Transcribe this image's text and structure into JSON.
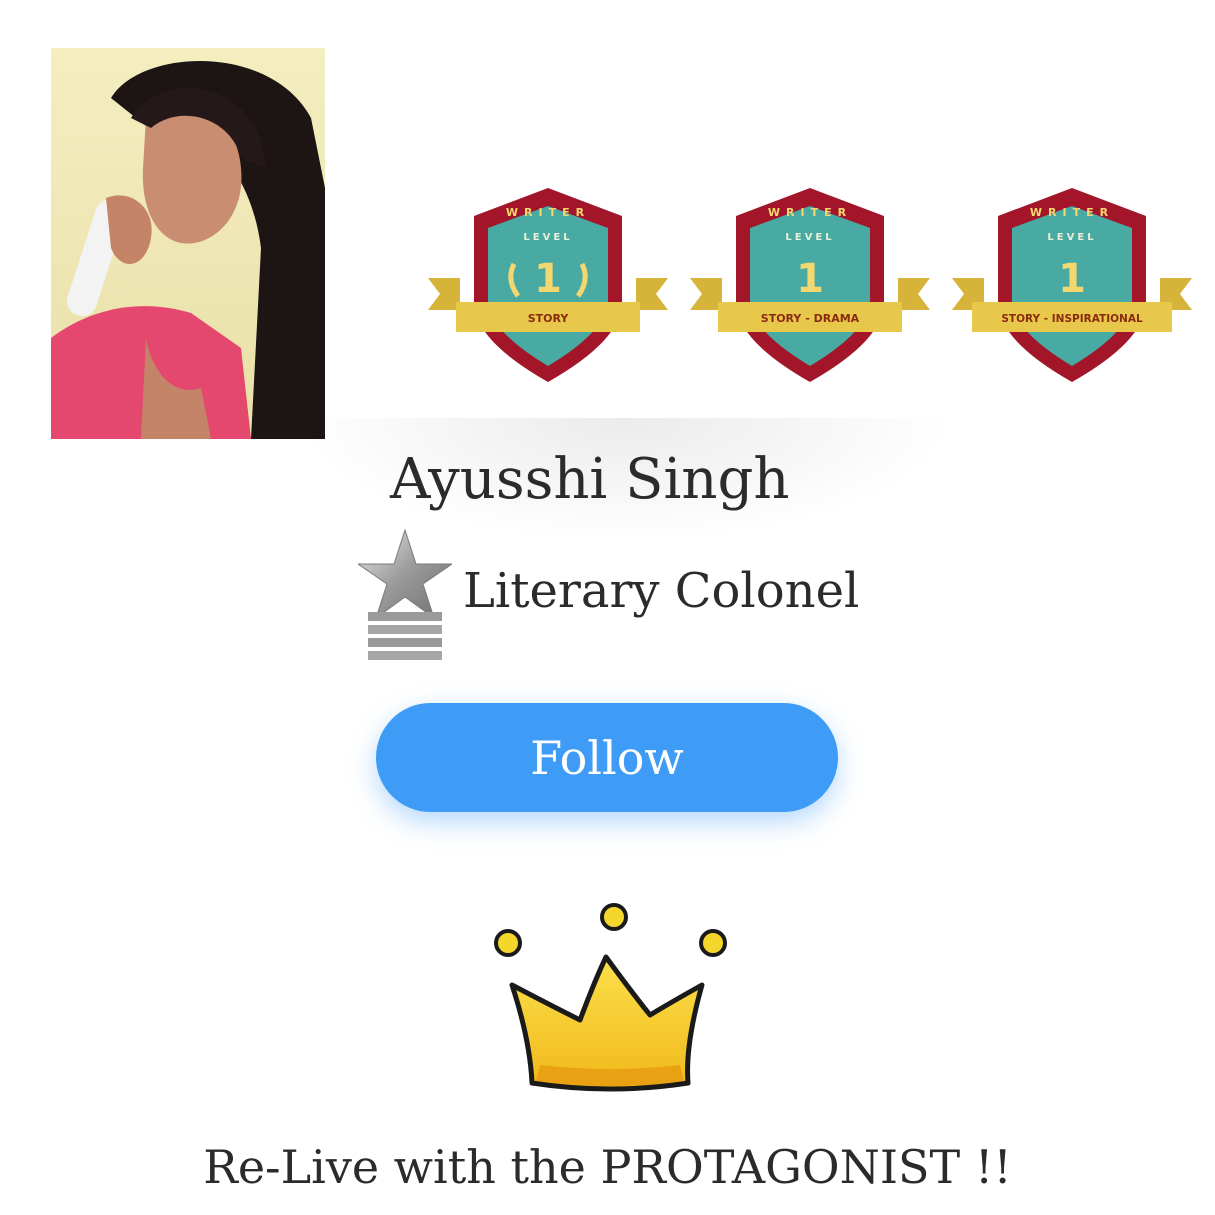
{
  "profile": {
    "name": "Ayusshi Singh",
    "rank": "Literary Colonel",
    "follow_label": "Follow",
    "tagline": "Re-Live with the PROTAGONIST !!"
  },
  "badges": [
    {
      "arc": "WRITER",
      "level_label": "LEVEL",
      "level": "1",
      "category": "STORY"
    },
    {
      "arc": "WRITER",
      "level_label": "LEVEL",
      "level": "1",
      "category": "STORY - DRAMA"
    },
    {
      "arc": "WRITER",
      "level_label": "LEVEL",
      "level": "1",
      "category": "STORY - INSPIRATIONAL"
    }
  ],
  "icons": {
    "rank": "silver-star-with-stripes-icon",
    "crown": "crown-icon"
  },
  "colors": {
    "follow_button": "#3f9cf6",
    "badge_shield": "#a3162a",
    "badge_inner": "#48aaa2",
    "badge_ribbon": "#e7c84a",
    "crown": "#f5c518"
  }
}
